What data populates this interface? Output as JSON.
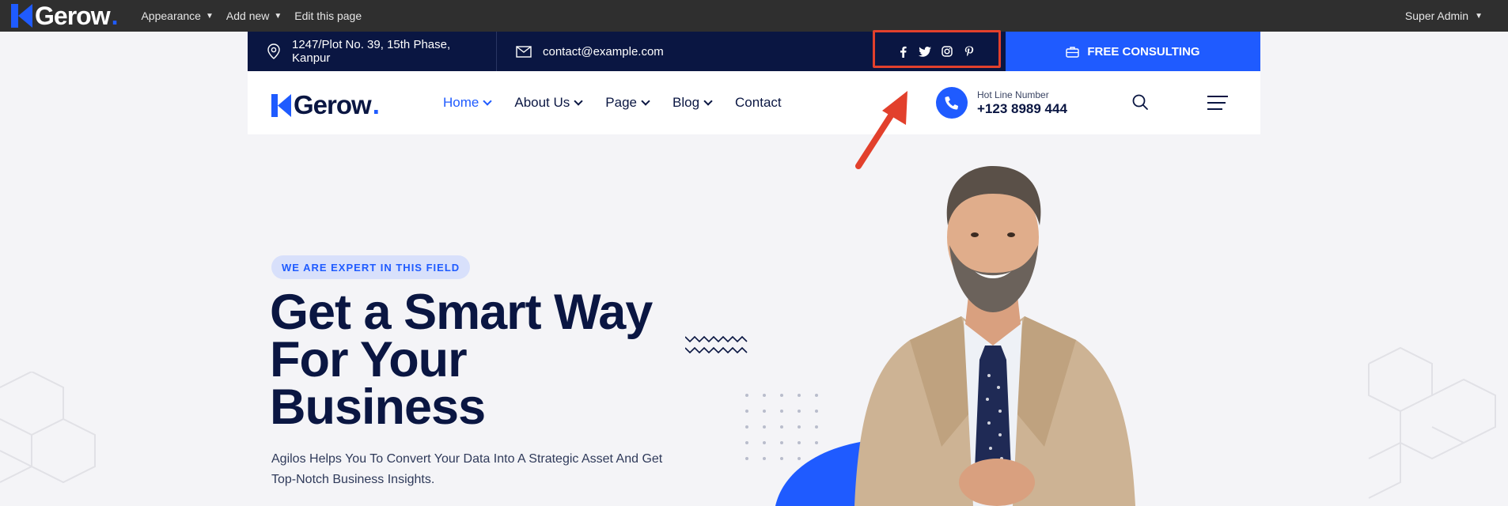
{
  "admin_bar": {
    "logo_text": "Gerow",
    "menu": [
      {
        "label": "Appearance",
        "has_dropdown": true
      },
      {
        "label": "Add new",
        "has_dropdown": true
      },
      {
        "label": "Edit this page",
        "has_dropdown": false
      }
    ],
    "user": "Super Admin"
  },
  "topbar": {
    "address": "1247/Plot No. 39, 15th Phase, Kanpur",
    "email": "contact@example.com",
    "socials": [
      "facebook-icon",
      "twitter-icon",
      "instagram-icon",
      "pinterest-icon"
    ],
    "cta_label": "FREE CONSULTING"
  },
  "header": {
    "logo_text": "Gerow",
    "nav": [
      {
        "label": "Home",
        "active": true,
        "has_dropdown": true
      },
      {
        "label": "About Us",
        "active": false,
        "has_dropdown": true
      },
      {
        "label": "Page",
        "active": false,
        "has_dropdown": true
      },
      {
        "label": "Blog",
        "active": false,
        "has_dropdown": true
      },
      {
        "label": "Contact",
        "active": false,
        "has_dropdown": false
      }
    ],
    "hotline_label": "Hot Line Number",
    "hotline_number": "+123 8989 444"
  },
  "hero": {
    "badge": "WE ARE EXPERT IN THIS FIELD",
    "title_lines": [
      "Get a Smart Way",
      "For Your",
      "Business"
    ],
    "description": "Agilos Helps You To Convert Your Data Into A Strategic Asset And Get Top-Notch Business Insights."
  },
  "colors": {
    "brand_blue": "#1f5bff",
    "navy": "#0a1642",
    "admin_bar": "#2f2f2f",
    "annotation_red": "#e2402c"
  }
}
